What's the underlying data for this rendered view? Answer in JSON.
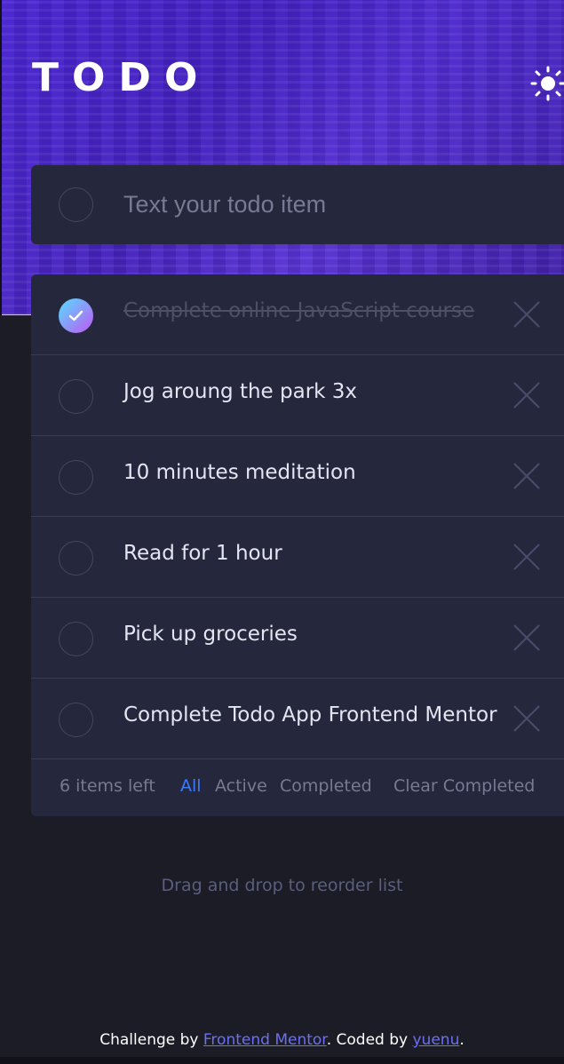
{
  "header": {
    "title": "TODO",
    "theme_icon": "sun-icon"
  },
  "new_todo": {
    "placeholder": "Text your todo item",
    "value": ""
  },
  "todos": [
    {
      "text": "Complete online JavaScript course",
      "completed": true
    },
    {
      "text": "Jog aroung the park 3x",
      "completed": false
    },
    {
      "text": "10 minutes meditation",
      "completed": false
    },
    {
      "text": "Read for 1 hour",
      "completed": false
    },
    {
      "text": "Pick up groceries",
      "completed": false
    },
    {
      "text": "Complete Todo App Frontend Mentor",
      "completed": false
    }
  ],
  "footer": {
    "items_left": "6 items left",
    "filters": [
      "All",
      "Active",
      "Completed"
    ],
    "active_filter": "All",
    "clear_label": "Clear Completed"
  },
  "hint": "Drag and drop to reorder list",
  "credit": {
    "prefix": "Challenge by ",
    "link1": "Frontend Mentor",
    "middle": ". Coded by ",
    "link2": "yuenu",
    "suffix": "."
  },
  "colors": {
    "accent": "#3a7cfd",
    "card": "#25273d",
    "background": "#1b1c26",
    "check_gradient_start": "#55ddff",
    "check_gradient_end": "#c058f3"
  }
}
